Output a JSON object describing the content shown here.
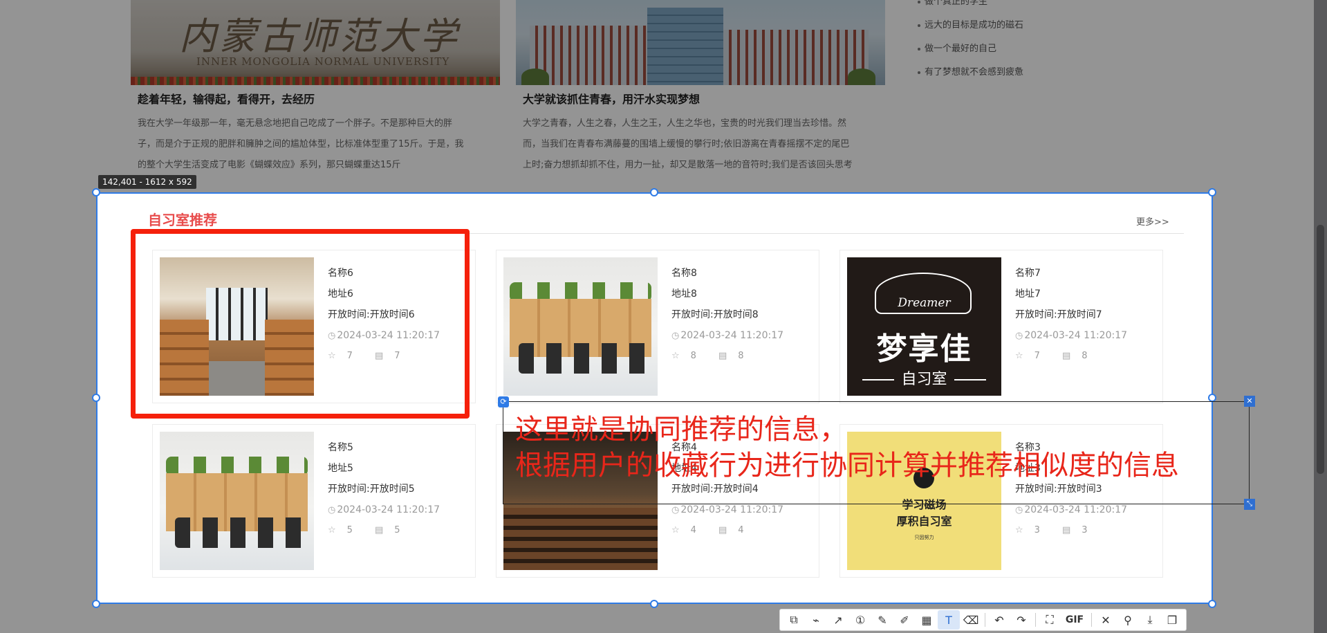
{
  "background": {
    "hero_1": {
      "carved_text": "内蒙古师范大学",
      "english_text": "INNER MONGOLIA NORMAL UNIVERSITY"
    },
    "articles": [
      {
        "title": "趁着年轻，输得起，看得开，去经历",
        "lines": [
          "我在大学一年级那一年，毫无悬念地把自己吃成了一个胖子。不是那种巨大的胖",
          "子，而是介于正规的肥胖和臃肿之间的尴尬体型，比标准体型重了15斤。于是，我",
          "的整个大学生活变成了电影《蝴蝶效应》系列，那只蝴蝶重达15斤"
        ]
      },
      {
        "title": "大学就该抓住青春，用汗水实现梦想",
        "lines": [
          "大学之青春，人生之春，人生之王，人生之华也，宝贵的时光我们理当去珍惜。然",
          "而，当我们在青春布满藤蔓的围墙上缓慢的攀行时;依旧游离在青春摇摆不定的尾巴",
          "上时;奋力想抓却抓不住，用力一扯，却又是散落一地的音符时;我们是否该回头思考"
        ]
      }
    ],
    "side_list": [
      "做个真正的学生",
      "远大的目标是成功的磁石",
      "做一个最好的自己",
      "有了梦想就不会感到疲惫"
    ]
  },
  "selection": {
    "label": "142,401 - 1612 x 592"
  },
  "section": {
    "title": "自习室推荐",
    "more": "更多>>"
  },
  "cards": [
    {
      "name": "名称6",
      "address": "地址6",
      "hours": "开放时间:开放时间6",
      "time": "2024-03-24 11:20:17",
      "stars": "7",
      "comments": "7"
    },
    {
      "name": "名称8",
      "address": "地址8",
      "hours": "开放时间:开放时间8",
      "time": "2024-03-24 11:20:17",
      "stars": "8",
      "comments": "8"
    },
    {
      "name": "名称7",
      "address": "地址7",
      "hours": "开放时间:开放时间7",
      "time": "2024-03-24 11:20:17",
      "stars": "7",
      "comments": "8"
    },
    {
      "name": "名称5",
      "address": "地址5",
      "hours": "开放时间:开放时间5",
      "time": "2024-03-24 11:20:17",
      "stars": "5",
      "comments": "5"
    },
    {
      "name": "名称4",
      "address": "地址4",
      "hours": "开放时间:开放时间4",
      "time": "2024-03-24 11:20:17",
      "stars": "4",
      "comments": "4"
    },
    {
      "name": "名称3",
      "address": "地址3",
      "hours": "开放时间:开放时间3",
      "time": "2024-03-24 11:20:17",
      "stars": "3",
      "comments": "3"
    }
  ],
  "thumbs": {
    "dreamer_brand": "Dreamer",
    "dreamer_cn": "梦享佳",
    "dreamer_sub": "自习室",
    "yellow_t1": "学习磁场",
    "yellow_t2": "厚积自习室",
    "yellow_t3": "只因努力"
  },
  "annotation": {
    "line1": "这里就是协同推荐的信息，",
    "line2": "根据用户的收藏行为进行协同计算并推荐相似度的信息",
    "color": "#e8261a"
  },
  "toolbar": {
    "gif_label": "GIF",
    "icons": [
      "shape-icon",
      "polyline-icon",
      "arrow-icon",
      "number-icon",
      "pencil-icon",
      "marker-icon",
      "mosaic-icon",
      "text-icon",
      "eraser-icon",
      "undo-icon",
      "redo-icon",
      "ocr-icon",
      "gif-icon",
      "close-icon",
      "pin-icon",
      "download-icon",
      "copy-icon"
    ]
  },
  "colors": {
    "selection": "#2f7be6",
    "red_frame": "#f5200b",
    "section_title": "#e84c4c"
  }
}
